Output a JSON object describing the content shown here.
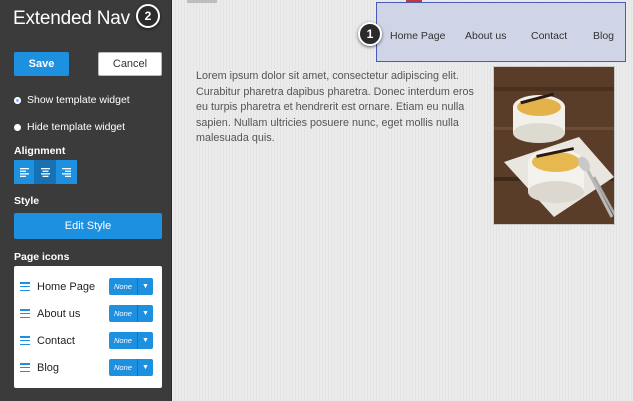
{
  "sidebar": {
    "title": "Extended Nav",
    "save_label": "Save",
    "cancel_label": "Cancel",
    "radio_options": [
      {
        "label": "Show template widget",
        "selected": true
      },
      {
        "label": "Hide template widget",
        "selected": false
      }
    ],
    "alignment_label": "Alignment",
    "alignment_options": [
      "align-left-icon",
      "align-center-icon",
      "align-right-icon"
    ],
    "alignment_selected": "center",
    "style_label": "Style",
    "edit_style_label": "Edit Style",
    "page_icons_label": "Page icons",
    "page_icons": [
      {
        "name": "Home Page",
        "icon": "None"
      },
      {
        "name": "About us",
        "icon": "None"
      },
      {
        "name": "Contact",
        "icon": "None"
      },
      {
        "name": "Blog",
        "icon": "None"
      }
    ]
  },
  "callouts": {
    "one": "1",
    "two": "2"
  },
  "nav": {
    "items": [
      "Home Page",
      "About us",
      "Contact",
      "Blog"
    ]
  },
  "content": {
    "paragraph": "Lorem ipsum dolor sit amet, consectetur adipiscing elit. Curabitur pharetra dapibus pharetra. Donec interdum eros eu turpis pharetra et hendrerit est ornare. Etiam eu nulla sapien. Nullam ultricies posuere nunc, eget mollis nulla malesuada quis."
  },
  "colors": {
    "accent": "#1e90e0",
    "sidebar_bg": "#3b3b3b",
    "nav_highlight": "#cfd5e6",
    "nav_border": "#4a5ab8"
  }
}
